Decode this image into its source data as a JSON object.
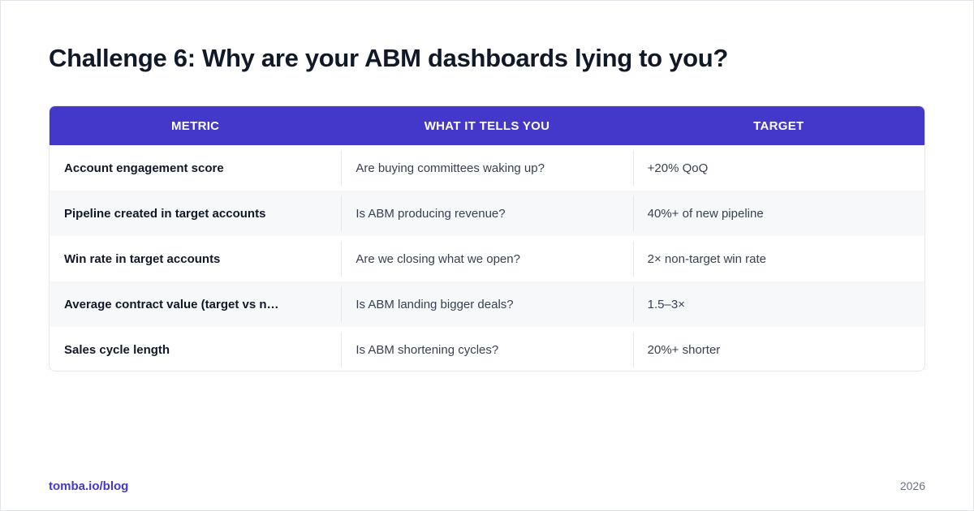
{
  "title": "Challenge 6: Why are your ABM dashboards lying to you?",
  "table": {
    "headers": [
      "METRIC",
      "WHAT IT TELLS YOU",
      "TARGET"
    ],
    "rows": [
      [
        "Account engagement score",
        "Are buying committees waking up?",
        "+20% QoQ"
      ],
      [
        "Pipeline created in target accounts",
        "Is ABM producing revenue?",
        "40%+ of new pipeline"
      ],
      [
        "Win rate in target accounts",
        "Are we closing what we open?",
        "2× non-target win rate"
      ],
      [
        "Average contract value (target vs n…",
        "Is ABM landing bigger deals?",
        "1.5–3×"
      ],
      [
        "Sales cycle length",
        "Is ABM shortening cycles?",
        "20%+ shorter"
      ]
    ]
  },
  "footer": {
    "link": "tomba.io/blog",
    "year": "2026"
  },
  "colors": {
    "header_bg": "#4338ca",
    "link": "#4338ca",
    "title": "#111827",
    "alt_row": "#f7f8fa"
  }
}
